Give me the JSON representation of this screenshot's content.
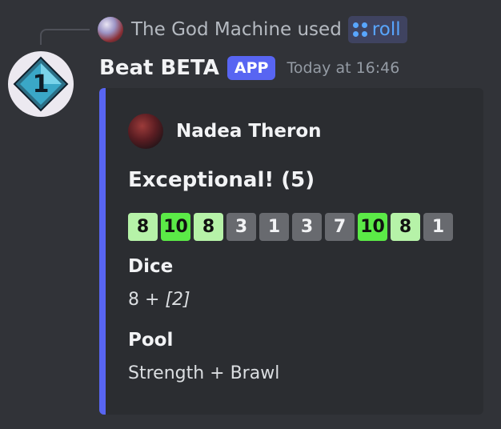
{
  "reply": {
    "user": "The God Machine",
    "action": "used",
    "command": "roll"
  },
  "message": {
    "bot_name": "Beat BETA",
    "tag": "APP",
    "timestamp": "Today at 16:46",
    "bot_avatar_label": "1"
  },
  "embed": {
    "accent_color": "#5865f2",
    "author": "Nadea Theron",
    "title": "Exceptional! (5)",
    "dice": [
      {
        "value": "8",
        "kind": "success"
      },
      {
        "value": "10",
        "kind": "exceptional"
      },
      {
        "value": "8",
        "kind": "success"
      },
      {
        "value": "3",
        "kind": "fail"
      },
      {
        "value": "1",
        "kind": "fail"
      },
      {
        "value": "3",
        "kind": "fail"
      },
      {
        "value": "7",
        "kind": "fail"
      },
      {
        "value": "10",
        "kind": "exceptional"
      },
      {
        "value": "8",
        "kind": "success"
      },
      {
        "value": "1",
        "kind": "fail"
      }
    ],
    "fields": [
      {
        "name": "Dice",
        "value_main": "8 + ",
        "value_italic": "[2]"
      },
      {
        "name": "Pool",
        "value_main": "Strength + Brawl",
        "value_italic": ""
      }
    ]
  }
}
